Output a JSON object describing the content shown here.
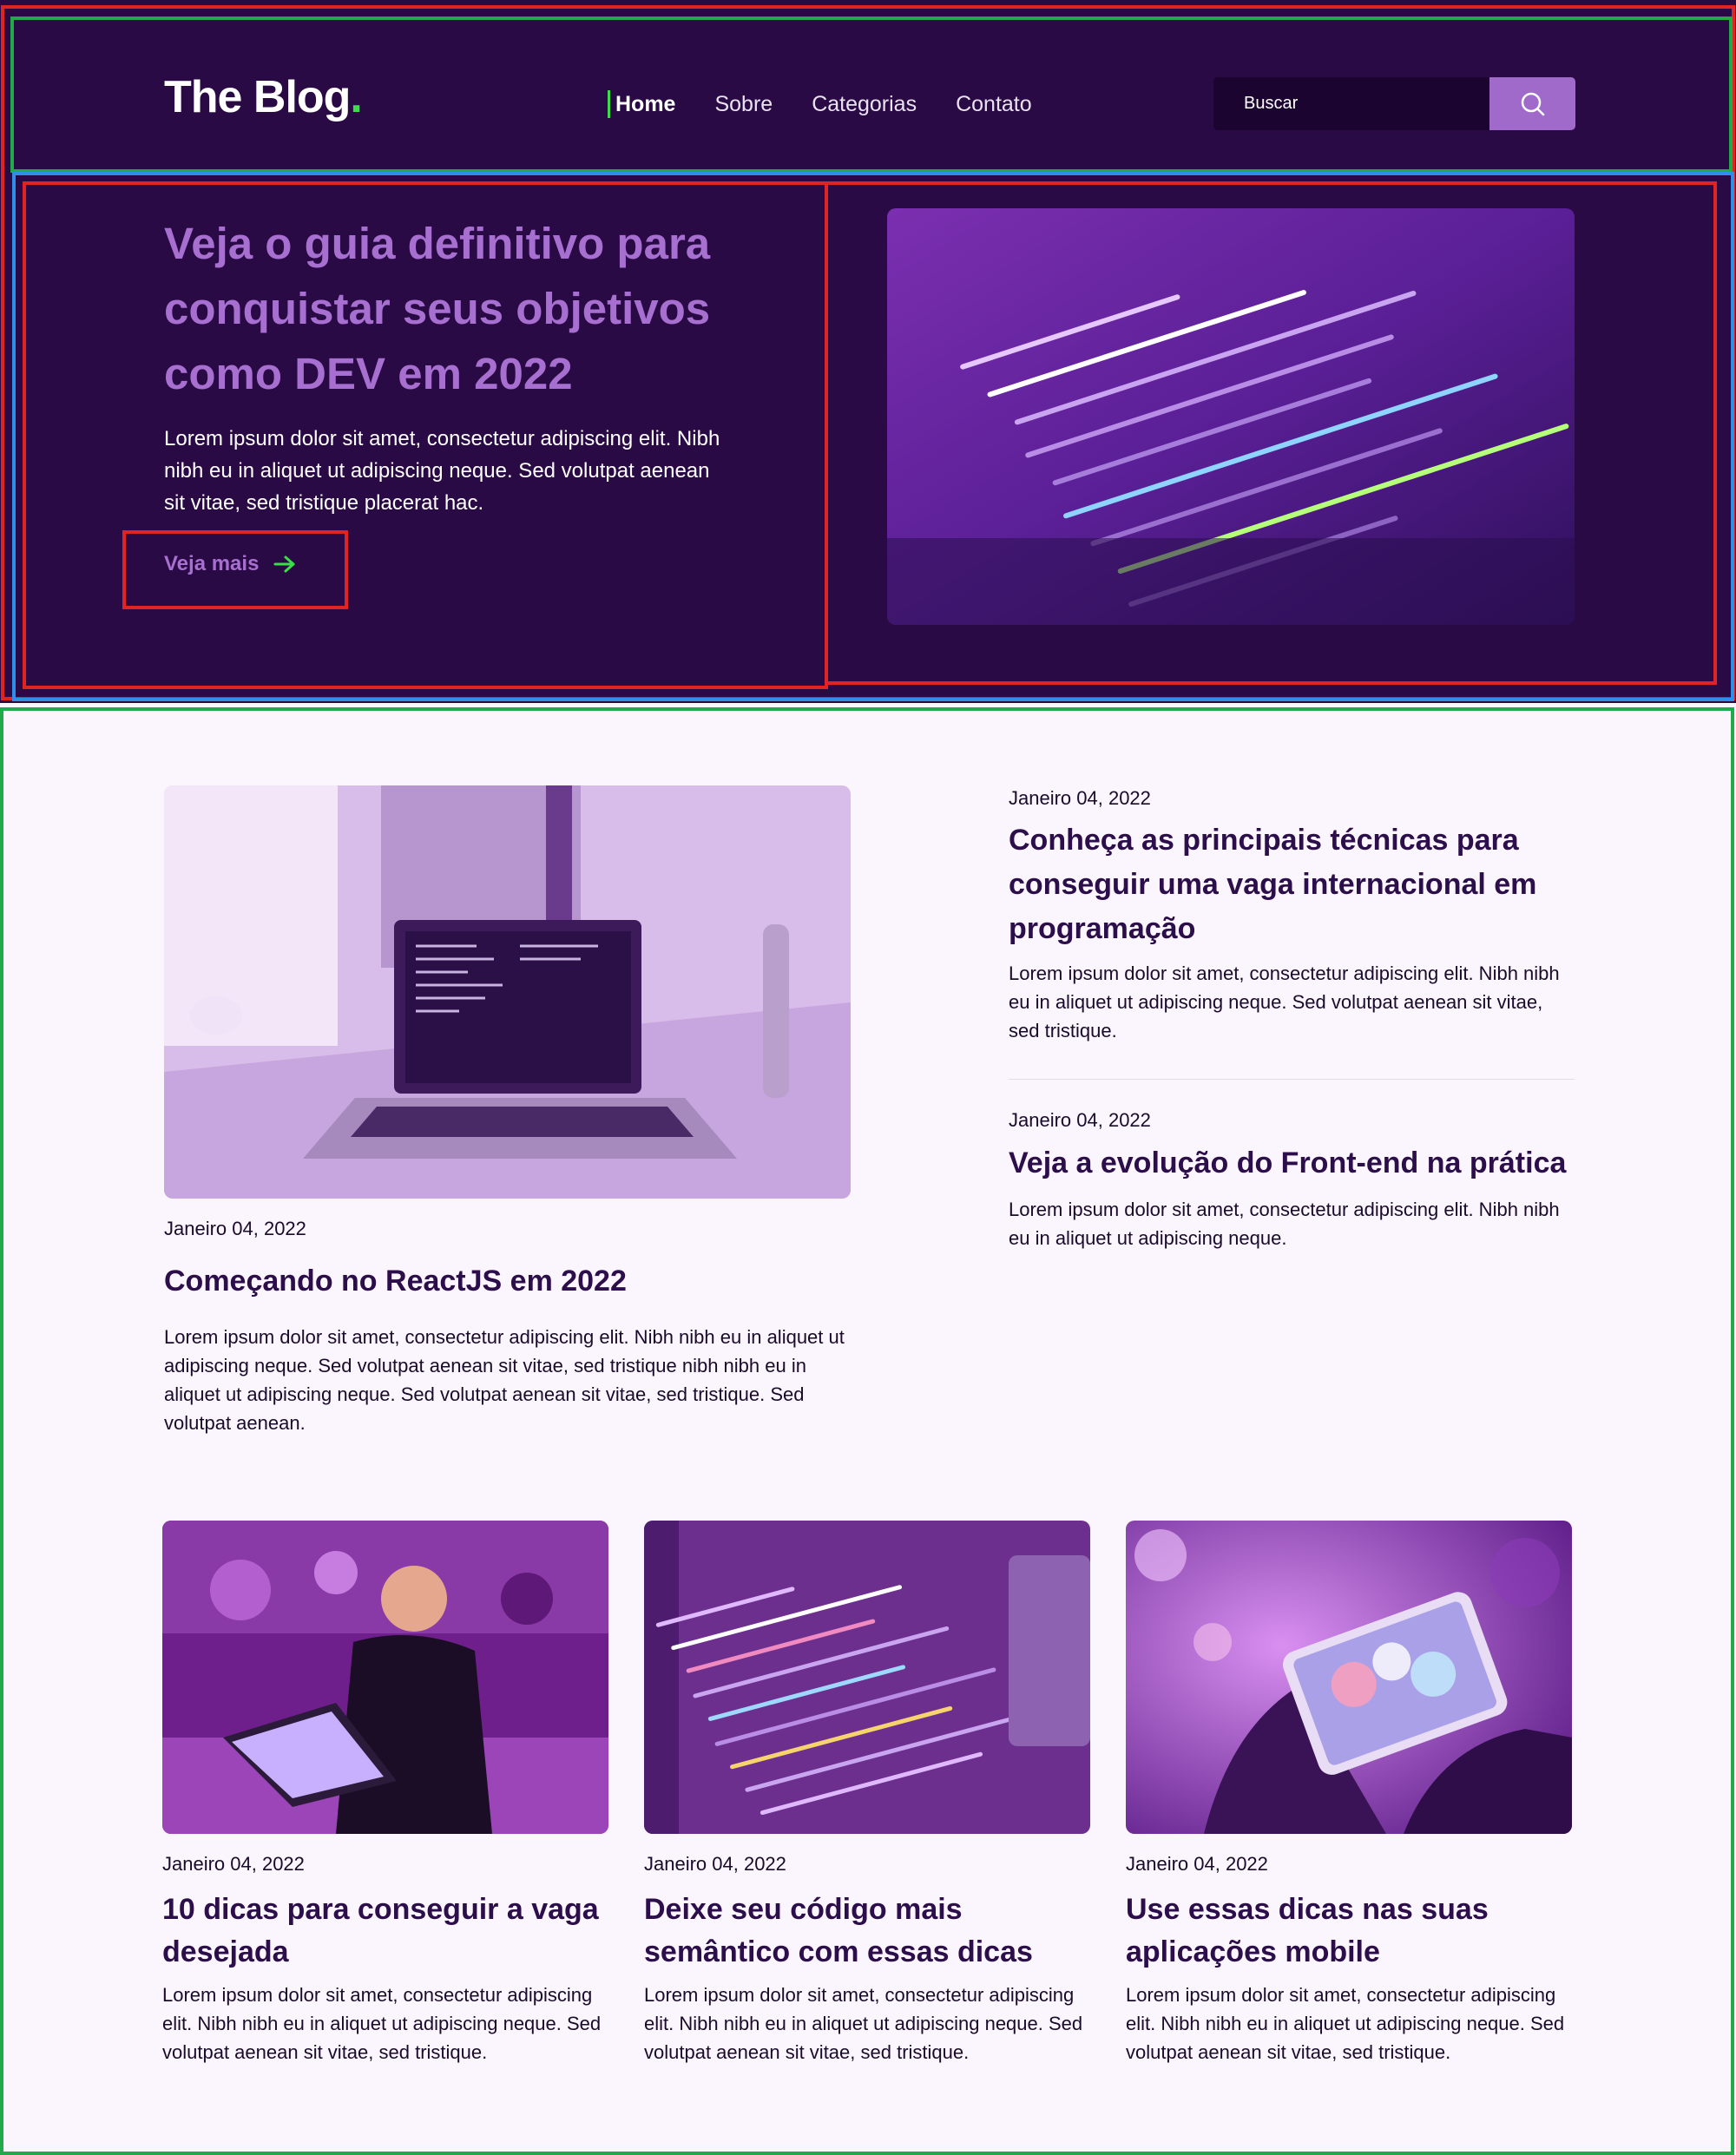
{
  "header": {
    "logo_text": "The Blog",
    "logo_dot": ".",
    "nav": [
      "Home",
      "Sobre",
      "Categorias",
      "Contato"
    ],
    "search_placeholder": "Buscar",
    "search_icon": "search-icon"
  },
  "hero": {
    "title": "Veja o guia definitivo para conquistar seus objetivos como DEV em 2022",
    "text": "Lorem ipsum dolor sit amet, consectetur adipiscing elit. Nibh nibh eu in aliquet ut adipiscing neque. Sed volutpat aenean sit vitae, sed tristique placerat hac.",
    "link_label": "Veja mais",
    "link_icon": "arrow-right-icon"
  },
  "featured": {
    "date": "Janeiro 04, 2022",
    "title": "Começando no ReactJS em 2022",
    "text": "Lorem ipsum dolor sit amet, consectetur adipiscing elit. Nibh nibh eu in aliquet ut adipiscing neque. Sed volutpat aenean sit vitae, sed tristique nibh nibh eu in aliquet ut adipiscing neque. Sed volutpat aenean sit vitae, sed tristique. Sed volutpat aenean."
  },
  "side_posts": [
    {
      "date": "Janeiro 04, 2022",
      "title": "Conheça as principais técnicas para conseguir uma vaga internacional em programação",
      "text": "Lorem ipsum dolor sit amet, consectetur adipiscing elit. Nibh nibh eu in aliquet ut adipiscing neque. Sed volutpat aenean sit vitae, sed tristique."
    },
    {
      "date": "Janeiro 04, 2022",
      "title": "Veja a evolução do Front-end na prática",
      "text": "Lorem ipsum dolor sit amet, consectetur adipiscing elit. Nibh nibh eu in aliquet ut adipiscing neque."
    }
  ],
  "grid_posts": [
    {
      "date": "Janeiro 04, 2022",
      "title": "10 dicas para conseguir a vaga desejada",
      "text": "Lorem ipsum dolor sit amet, consectetur adipiscing elit. Nibh nibh eu in aliquet ut adipiscing neque. Sed volutpat aenean sit vitae, sed tristique."
    },
    {
      "date": "Janeiro 04, 2022",
      "title": "Deixe seu código mais semântico com essas dicas",
      "text": "Lorem ipsum dolor sit amet, consectetur adipiscing elit. Nibh nibh eu in aliquet ut adipiscing neque. Sed volutpat aenean sit vitae, sed tristique."
    },
    {
      "date": "Janeiro 04, 2022",
      "title": "Use essas dicas nas suas aplicações mobile",
      "text": "Lorem ipsum dolor sit amet, consectetur adipiscing elit. Nibh nibh eu in aliquet ut adipiscing neque. Sed volutpat aenean sit vitae, sed tristique."
    }
  ],
  "colors": {
    "header_bg": "#2a0a45",
    "accent_purple": "#a66fd0",
    "accent_green": "#3ddc4a",
    "page_bg": "#fbf5fd",
    "title_dark": "#2b0e4a"
  }
}
